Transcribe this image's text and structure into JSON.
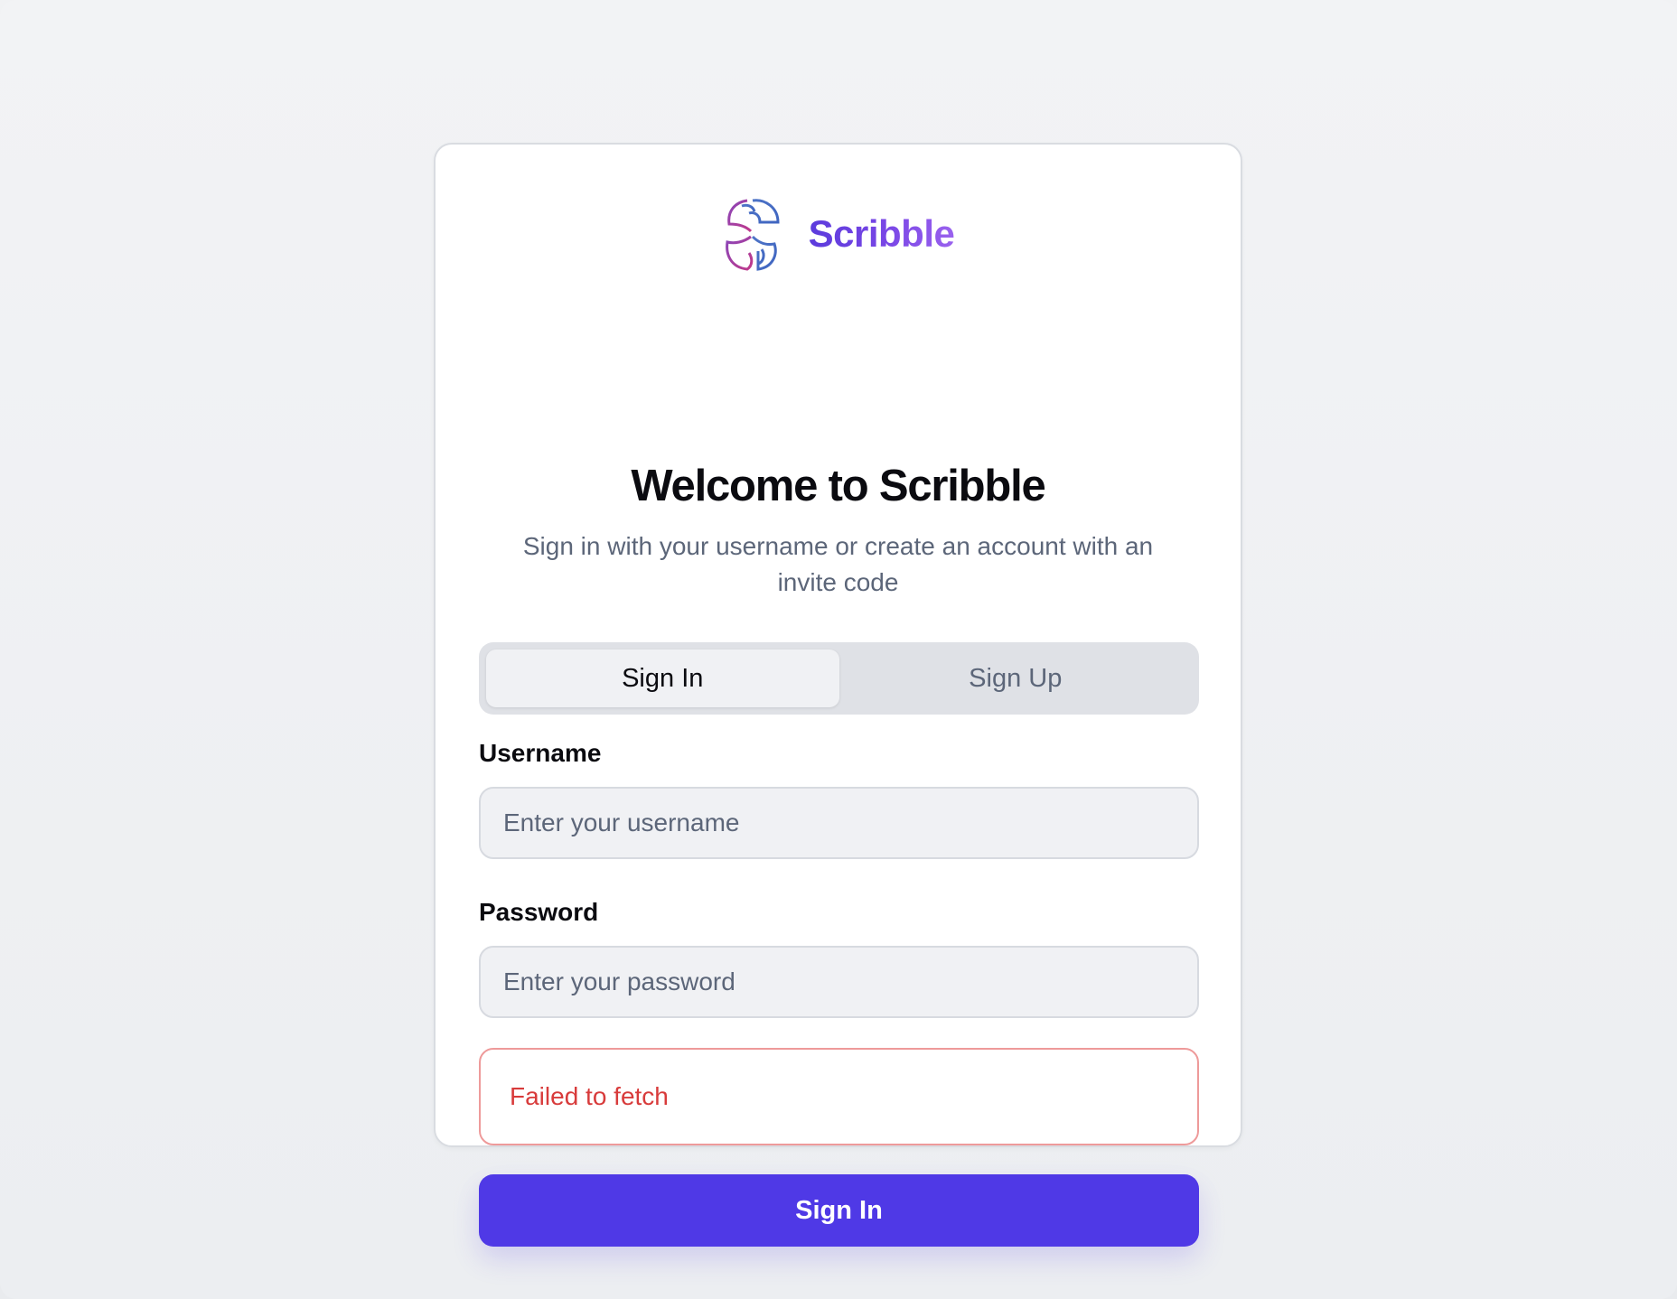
{
  "brand": {
    "name": "Scribble",
    "logo_icon": "scribble-s-logo-icon",
    "gradient_colors": [
      "#5b3bdc",
      "#9a62ee"
    ]
  },
  "heading": {
    "title": "Welcome to Scribble",
    "subtitle": "Sign in with your username or create an account with an invite code"
  },
  "tabs": [
    {
      "label": "Sign In",
      "active": true
    },
    {
      "label": "Sign Up",
      "active": false
    }
  ],
  "form": {
    "username": {
      "label": "Username",
      "value": "",
      "placeholder": "Enter your username"
    },
    "password": {
      "label": "Password",
      "value": "",
      "placeholder": "Enter your password"
    },
    "error_message": "Failed to fetch",
    "submit_label": "Sign In"
  },
  "colors": {
    "accent": "#4f39e6",
    "error": "#d83b3b",
    "error_border": "#ee9a9a",
    "muted_text": "#5c6679"
  }
}
